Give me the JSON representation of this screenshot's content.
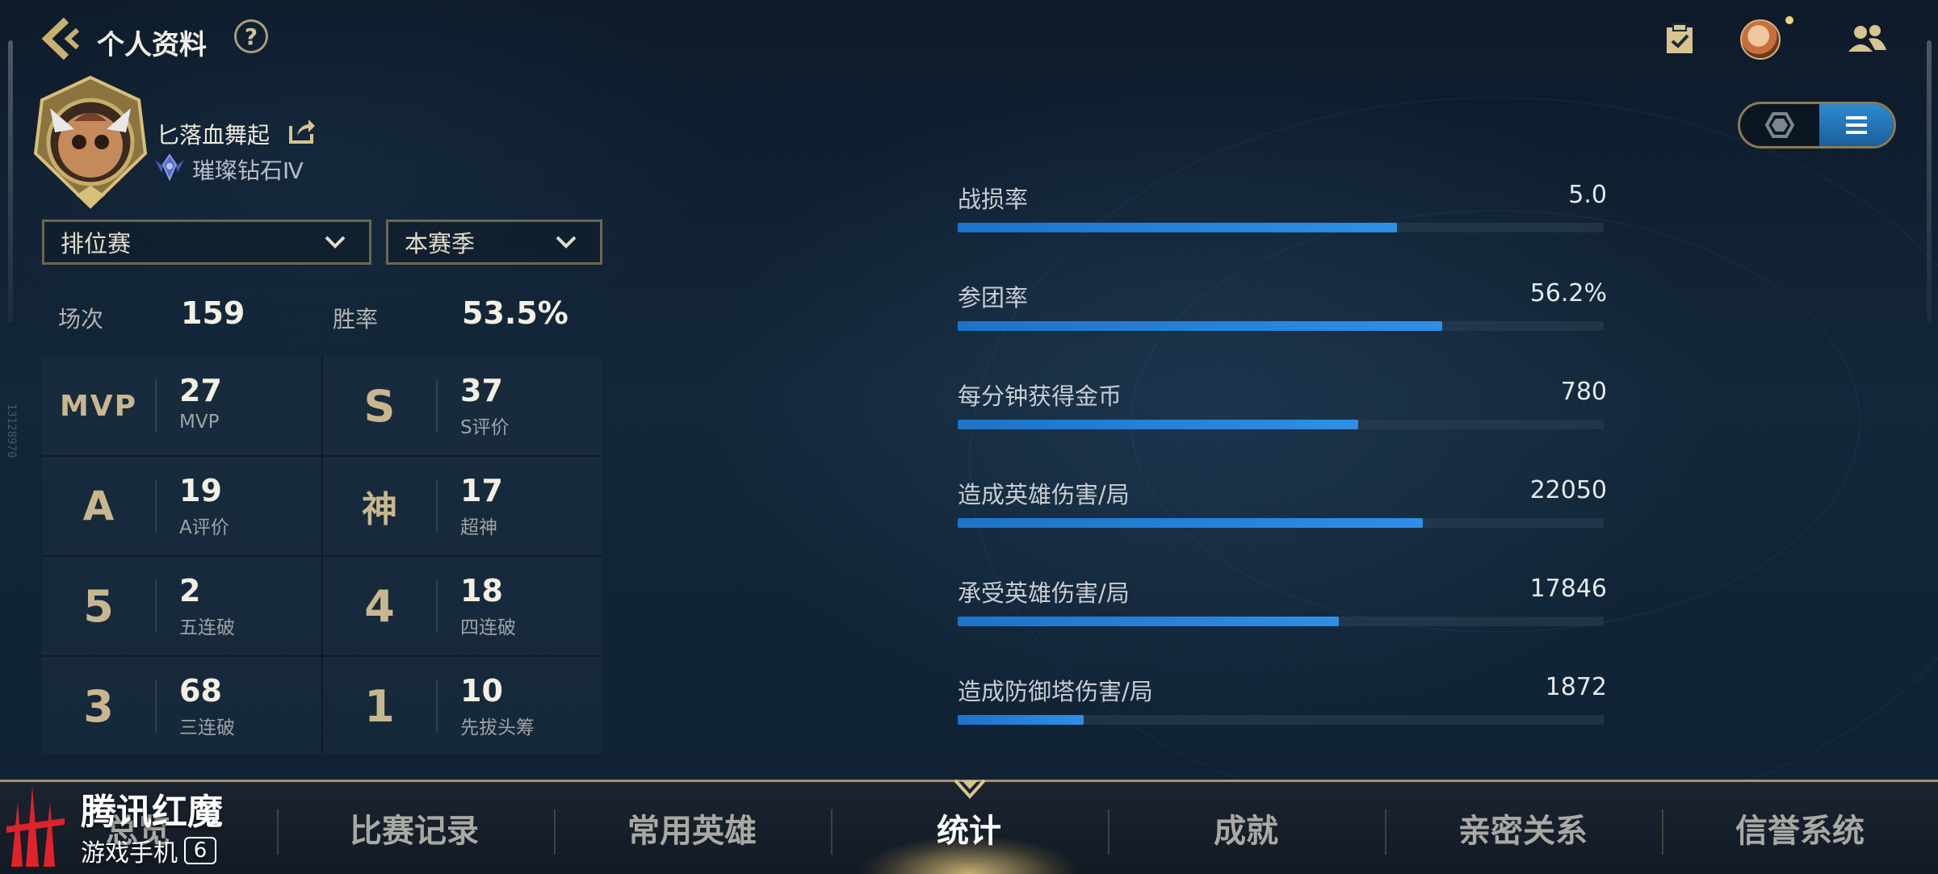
{
  "header": {
    "title": "个人资料",
    "help_label": "?"
  },
  "side_id": "13128970",
  "profile": {
    "player_name": "匕落血舞起",
    "rank": "璀璨钻石Ⅳ"
  },
  "filters": {
    "mode": "排位赛",
    "season": "本赛季"
  },
  "summary": {
    "matches_label": "场次",
    "matches_value": "159",
    "winrate_label": "胜率",
    "winrate_value": "53.5%"
  },
  "stats": [
    {
      "badge": "MVP",
      "value": "27",
      "label": "MVP"
    },
    {
      "badge": "S",
      "value": "37",
      "label": "S评价"
    },
    {
      "badge": "A",
      "value": "19",
      "label": "A评价"
    },
    {
      "badge": "神",
      "value": "17",
      "label": "超神"
    },
    {
      "badge": "5",
      "value": "2",
      "label": "五连破"
    },
    {
      "badge": "4",
      "value": "18",
      "label": "四连破"
    },
    {
      "badge": "3",
      "value": "68",
      "label": "三连破"
    },
    {
      "badge": "1",
      "value": "10",
      "label": "先拔头筹"
    }
  ],
  "metrics": [
    {
      "label": "战损率",
      "value": "5.0",
      "progress": 0.68
    },
    {
      "label": "参团率",
      "value": "56.2%",
      "progress": 0.75
    },
    {
      "label": "每分钟获得金币",
      "value": "780",
      "progress": 0.62
    },
    {
      "label": "造成英雄伤害/局",
      "value": "22050",
      "progress": 0.72
    },
    {
      "label": "承受英雄伤害/局",
      "value": "17846",
      "progress": 0.59
    },
    {
      "label": "造成防御塔伤害/局",
      "value": "1872",
      "progress": 0.195
    }
  ],
  "bottom_nav": {
    "tabs": [
      "总览",
      "比赛记录",
      "常用英雄",
      "统计",
      "成就",
      "亲密关系",
      "信誉系统"
    ],
    "active": "统计"
  },
  "watermark": {
    "title": "腾讯红魔",
    "subtitle": "游戏手机",
    "badge": "6"
  },
  "icons": {
    "back": "back-arrow-icon",
    "task": "task-clipboard-icon",
    "friends": "friends-icon",
    "share": "share-icon",
    "rank": "diamond-rank-icon"
  },
  "colors": {
    "accent_blue": "#2f8fe6",
    "gold": "#c8b78e",
    "background": "#13273a"
  }
}
